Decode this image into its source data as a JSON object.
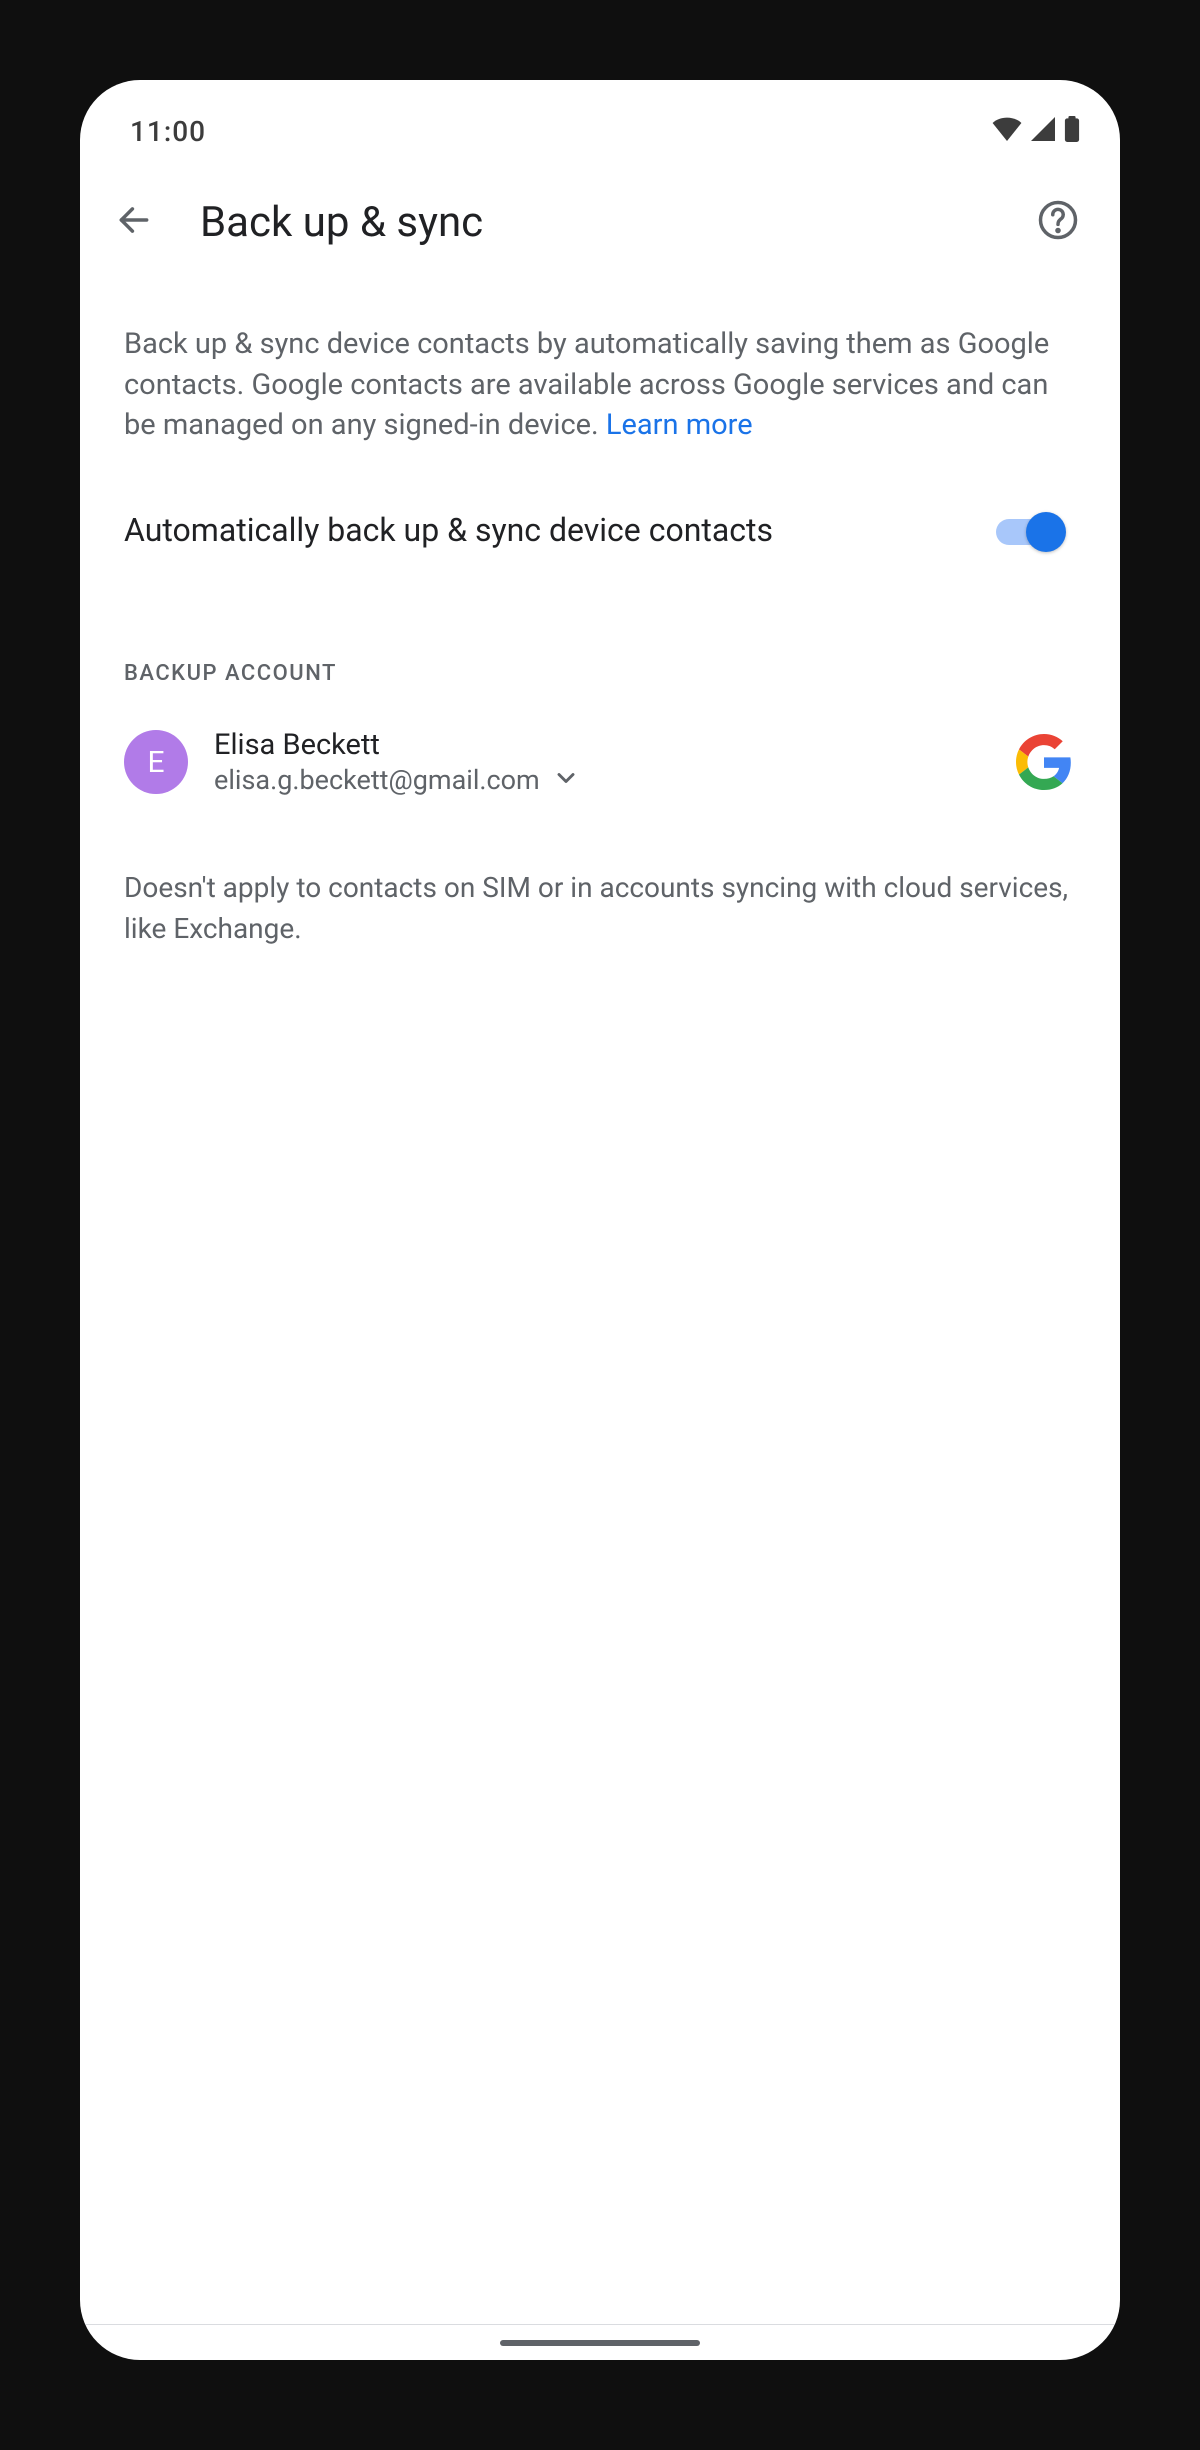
{
  "status": {
    "time": "11:00"
  },
  "header": {
    "title": "Back up & sync"
  },
  "body": {
    "description_pre": "Back up & sync device contacts by automatically saving them as Google contacts. Google contacts are available across Google services and can be managed on any signed-in device. ",
    "learn_more": "Learn more",
    "toggle_label": "Automatically back up & sync device contacts",
    "toggle_on": true,
    "section_header": "BACKUP ACCOUNT",
    "account": {
      "initial": "E",
      "name": "Elisa Beckett",
      "email": "elisa.g.beckett@gmail.com"
    },
    "footnote": "Doesn't apply to contacts on SIM or in accounts syncing with cloud services, like Exchange."
  }
}
